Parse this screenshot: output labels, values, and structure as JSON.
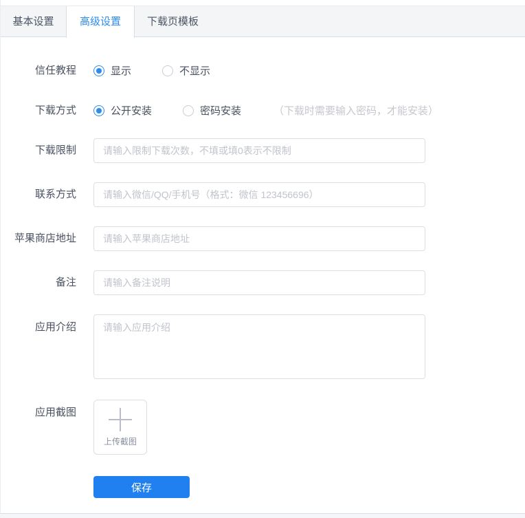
{
  "tabs": [
    {
      "label": "基本设置",
      "active": false
    },
    {
      "label": "高级设置",
      "active": true
    },
    {
      "label": "下载页模板",
      "active": false
    }
  ],
  "form": {
    "trust_tutorial": {
      "label": "信任教程",
      "options": [
        {
          "label": "显示",
          "selected": true
        },
        {
          "label": "不显示",
          "selected": false
        }
      ]
    },
    "download_method": {
      "label": "下载方式",
      "options": [
        {
          "label": "公开安装",
          "selected": true
        },
        {
          "label": "密码安装",
          "selected": false
        }
      ],
      "hint": "（下载时需要输入密码，才能安装）"
    },
    "download_limit": {
      "label": "下载限制",
      "placeholder": "请输入限制下载次数，不填或填0表示不限制",
      "value": ""
    },
    "contact": {
      "label": "联系方式",
      "placeholder": "请输入微信/QQ/手机号（格式：微信 123456696）",
      "value": ""
    },
    "apple_store": {
      "label": "苹果商店地址",
      "placeholder": "请输入苹果商店地址",
      "value": ""
    },
    "remark": {
      "label": "备注",
      "placeholder": "请输入备注说明",
      "value": ""
    },
    "app_intro": {
      "label": "应用介绍",
      "placeholder": "请输入应用介绍",
      "value": ""
    },
    "app_screenshot": {
      "label": "应用截图",
      "upload_text": "上传截图"
    },
    "save_label": "保存"
  },
  "colors": {
    "primary": "#2d8cf0",
    "button": "#2080f0",
    "tab_bg": "#f4f5f7",
    "border": "#dcdee2",
    "placeholder": "#c0c4cc"
  }
}
